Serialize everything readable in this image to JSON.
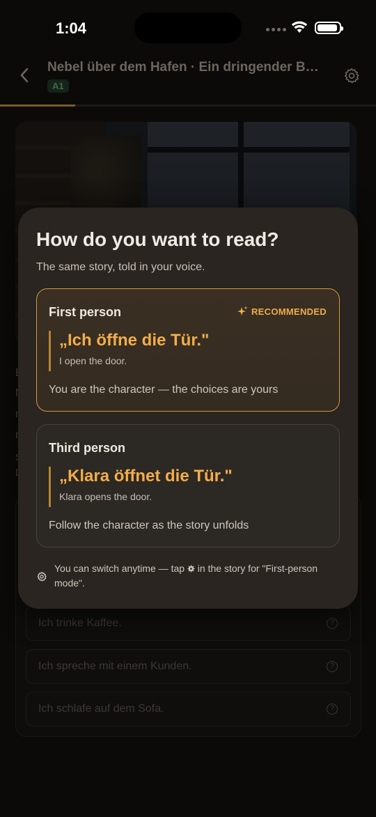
{
  "status_bar": {
    "time": "1:04"
  },
  "header": {
    "title": "Nebel über dem Hafen · Ein dringender Besucher",
    "level": "A1",
    "progress_fraction": 0.2
  },
  "background": {
    "text_fragments": [
      "E",
      "N",
      "n",
      "n",
      "S",
      "D"
    ],
    "options": [
      {
        "label": "Ich trinke Kaffee."
      },
      {
        "label": "Ich spreche mit einem Kunden."
      },
      {
        "label": "Ich schlafe auf dem Sofa."
      }
    ]
  },
  "sheet": {
    "title": "How do you want to read?",
    "subtitle": "The same story, told in your voice.",
    "first_person": {
      "label": "First person",
      "badge": "RECOMMENDED",
      "quote": "„Ich öffne die Tür.\"",
      "translation": "I open the door.",
      "description": "You are the character — the choices are yours"
    },
    "third_person": {
      "label": "Third person",
      "quote": "„Klara öffnet die Tür.\"",
      "translation": "Klara opens the door.",
      "description": "Follow the character as the story unfolds"
    },
    "footer_before": "You can switch anytime — tap ",
    "footer_after": " in the story for \"First-person mode\"."
  },
  "colors": {
    "accent": "#f2ad4a",
    "selected_border": "#d39a3c",
    "sheet_bg": "#2a2520"
  },
  "icons": [
    "back-icon",
    "gear-icon",
    "sparkle-icon",
    "help-icon",
    "wifi-icon",
    "battery-icon"
  ]
}
